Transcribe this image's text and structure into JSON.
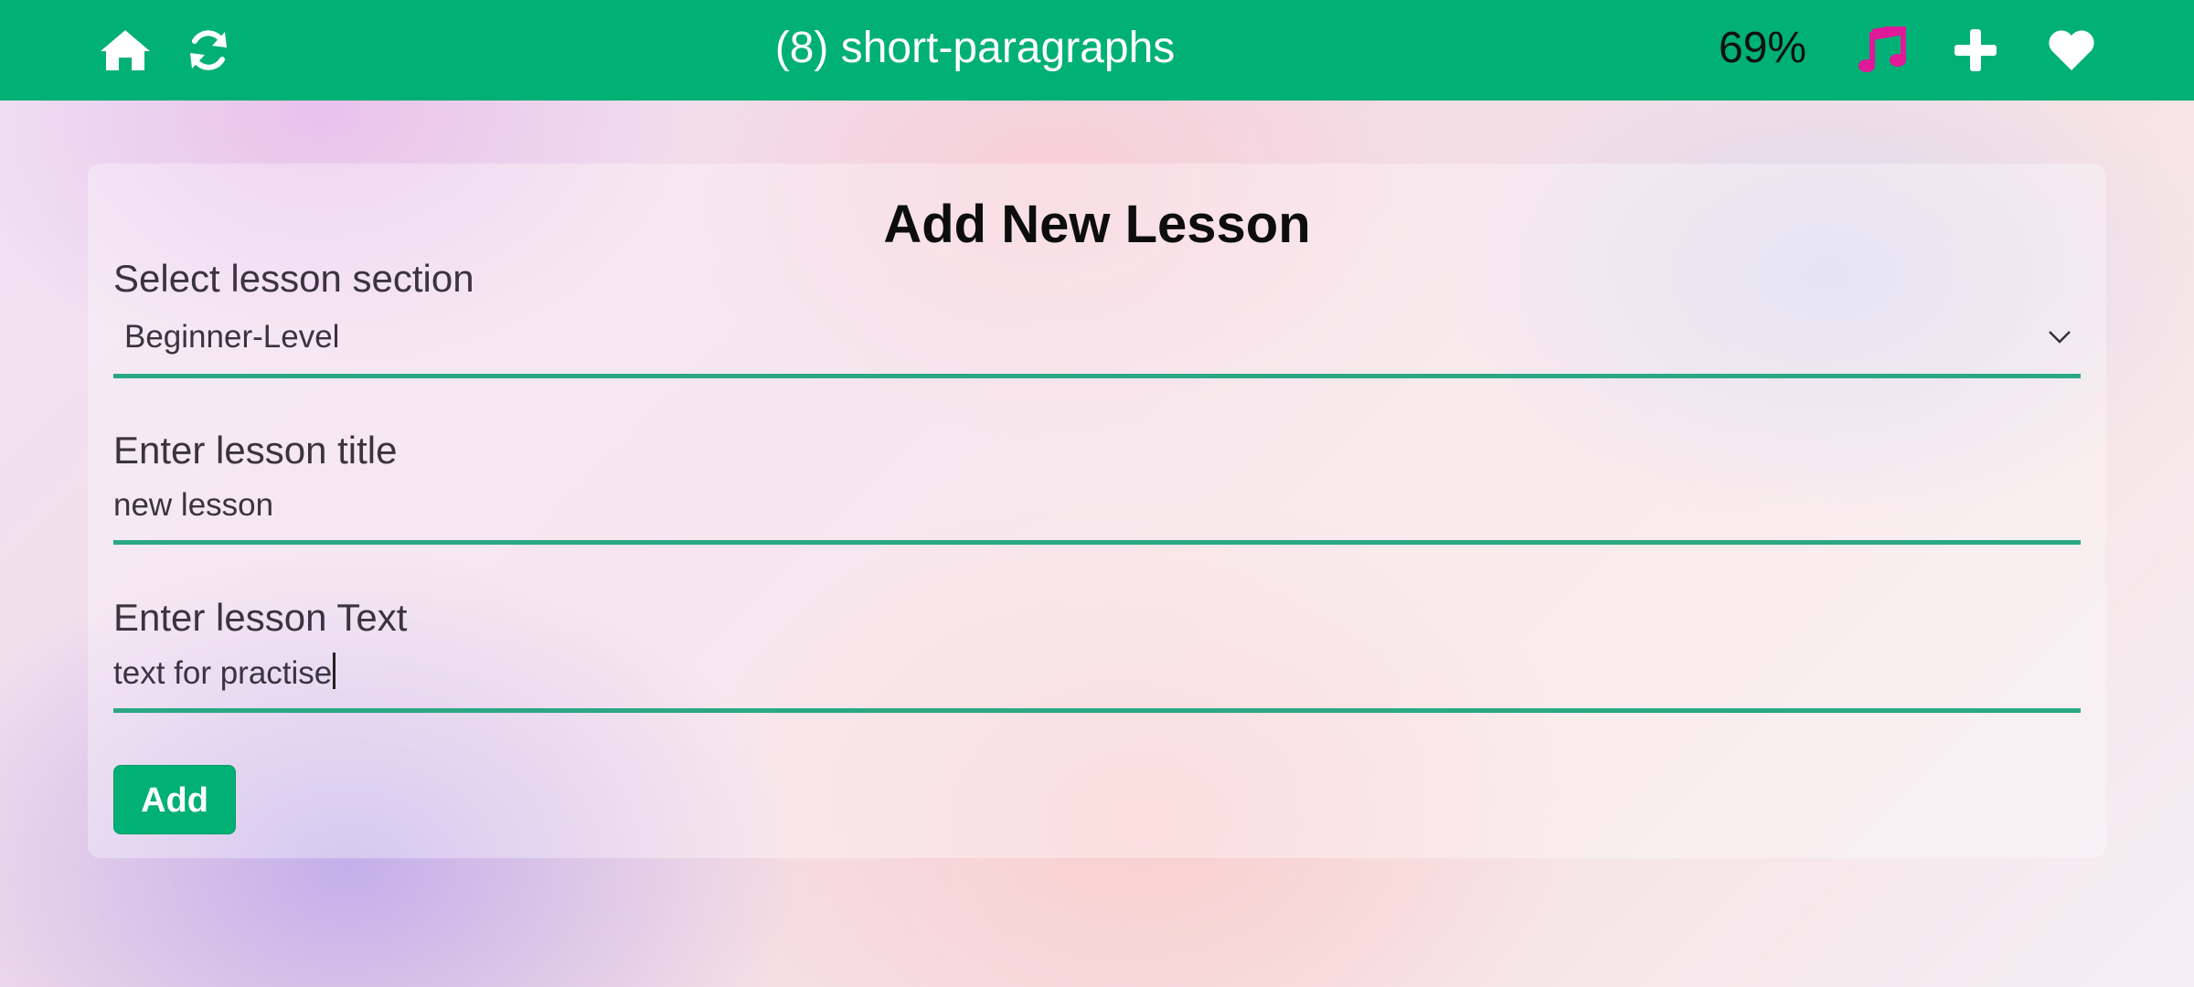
{
  "header": {
    "title": "(8) short-paragraphs",
    "percent": "69%",
    "icons": {
      "home": "home-icon",
      "refresh": "refresh-icon",
      "music": "music-note-icon",
      "add": "plus-icon",
      "favorite": "heart-icon"
    },
    "colors": {
      "bar": "#00b074",
      "music_icon": "#e0189a",
      "icons": "#ffffff"
    }
  },
  "form": {
    "heading": "Add New Lesson",
    "section_label": "Select lesson section",
    "section_value": "Beginner-Level",
    "title_label": "Enter lesson title",
    "title_value": "new lesson",
    "text_label": "Enter lesson Text",
    "text_value": "text for practise",
    "submit_label": "Add",
    "accent_color": "#2aa884"
  }
}
